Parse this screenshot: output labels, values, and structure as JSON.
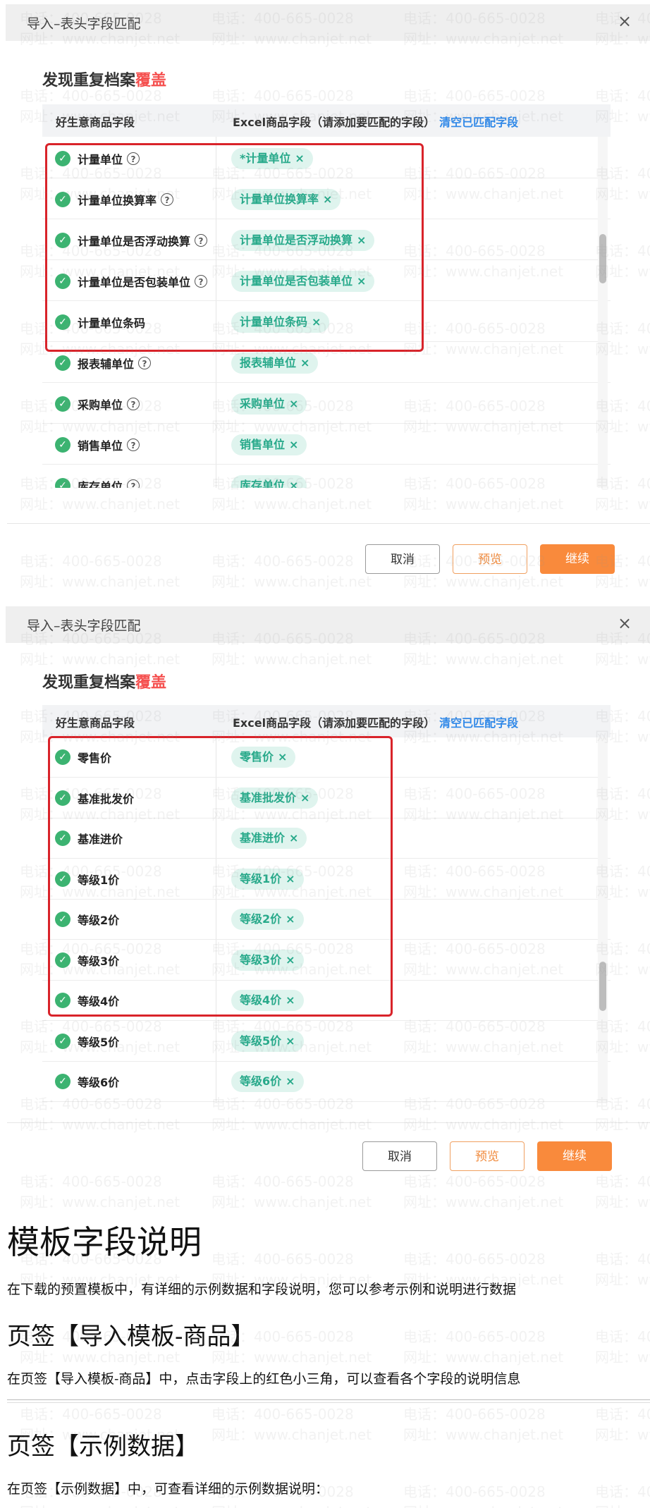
{
  "watermark": {
    "phone": "电话：400-665-0028",
    "site": "网址：www.chanjet.net"
  },
  "dialogs": [
    {
      "title": "导入–表头字段匹配",
      "close_symbol": "×",
      "subtitle_prefix": "发现重复档案",
      "subtitle_highlight": "覆盖",
      "col_left": "好生意商品字段",
      "col_right": "Excel商品字段（请添加要匹配的字段）",
      "clear_link": "清空已匹配字段",
      "rows": [
        {
          "name": "计量单位",
          "help": true,
          "tag": "*计量单位"
        },
        {
          "name": "计量单位换算率",
          "help": true,
          "tag": "计量单位换算率"
        },
        {
          "name": "计量单位是否浮动换算",
          "help": true,
          "tag": "计量单位是否浮动换算"
        },
        {
          "name": "计量单位是否包装单位",
          "help": true,
          "tag": "计量单位是否包装单位"
        },
        {
          "name": "计量单位条码",
          "help": false,
          "tag": "计量单位条码"
        },
        {
          "name": "报表辅单位",
          "help": true,
          "tag": "报表辅单位"
        },
        {
          "name": "采购单位",
          "help": true,
          "tag": "采购单位"
        },
        {
          "name": "销售单位",
          "help": true,
          "tag": "销售单位"
        },
        {
          "name": "库存单位",
          "help": true,
          "tag": "库存单位"
        }
      ],
      "buttons": {
        "cancel": "取消",
        "preview": "预览",
        "continue": "继续"
      }
    },
    {
      "title": "导入–表头字段匹配",
      "close_symbol": "×",
      "subtitle_prefix": "发现重复档案",
      "subtitle_highlight": "覆盖",
      "col_left": "好生意商品字段",
      "col_right": "Excel商品字段（请添加要匹配的字段）",
      "clear_link": "清空已匹配字段",
      "rows": [
        {
          "name": "零售价",
          "help": false,
          "tag": "零售价"
        },
        {
          "name": "基准批发价",
          "help": false,
          "tag": "基准批发价"
        },
        {
          "name": "基准进价",
          "help": false,
          "tag": "基准进价"
        },
        {
          "name": "等级1价",
          "help": false,
          "tag": "等级1价"
        },
        {
          "name": "等级2价",
          "help": false,
          "tag": "等级2价"
        },
        {
          "name": "等级3价",
          "help": false,
          "tag": "等级3价"
        },
        {
          "name": "等级4价",
          "help": false,
          "tag": "等级4价"
        },
        {
          "name": "等级5价",
          "help": false,
          "tag": "等级5价"
        },
        {
          "name": "等级6价",
          "help": false,
          "tag": "等级6价"
        }
      ],
      "buttons": {
        "cancel": "取消",
        "preview": "预览",
        "continue": "继续"
      }
    }
  ],
  "tag_remove_symbol": "×",
  "help_symbol": "?",
  "check_symbol": "✓",
  "doc": {
    "h1": "模板字段说明",
    "p1": "在下载的预置模板中，有详细的示例数据和字段说明，您可以参考示例和说明进行数据",
    "h2a": "页签【导入模板-商品】",
    "p2": "在页签【导入模板-商品】中，点击字段上的红色小三角，可以查看各个字段的说明信息",
    "h2b": "页签【示例数据】",
    "p3": "在页签【示例数据】中，可查看详细的示例数据说明："
  },
  "colors": {
    "accent_orange": "#f98a3c",
    "tag_green": "#27a98a",
    "check_green": "#3cb371",
    "highlight_red": "#f5504f",
    "link_blue": "#2f88e8",
    "redbox": "#d9232a"
  }
}
